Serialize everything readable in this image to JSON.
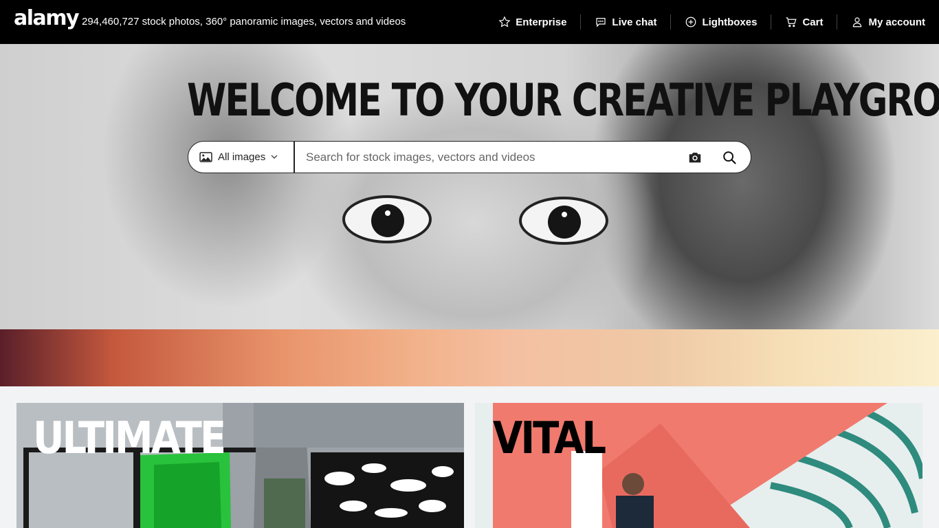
{
  "header": {
    "logo": "alamy",
    "tagline": "294,460,727 stock photos, 360° panoramic images, vectors and videos",
    "nav": [
      {
        "label": "Enterprise",
        "icon": "star-icon"
      },
      {
        "label": "Live chat",
        "icon": "chat-icon"
      },
      {
        "label": "Lightboxes",
        "icon": "plus-circle-icon"
      },
      {
        "label": "Cart",
        "icon": "cart-icon"
      },
      {
        "label": "My account",
        "icon": "user-icon"
      }
    ]
  },
  "hero": {
    "title": "WELCOME TO YOUR CREATIVE PLAYGROUND",
    "search": {
      "scope_label": "All images",
      "placeholder": "Search for stock images, vectors and videos"
    }
  },
  "cards": [
    {
      "title": "ULTIMATE"
    },
    {
      "title": "VITAL"
    }
  ],
  "colors": {
    "topbar_bg": "#000000",
    "page_bg": "#f2f3f5",
    "vital_card_accent": "#f07a6e"
  }
}
